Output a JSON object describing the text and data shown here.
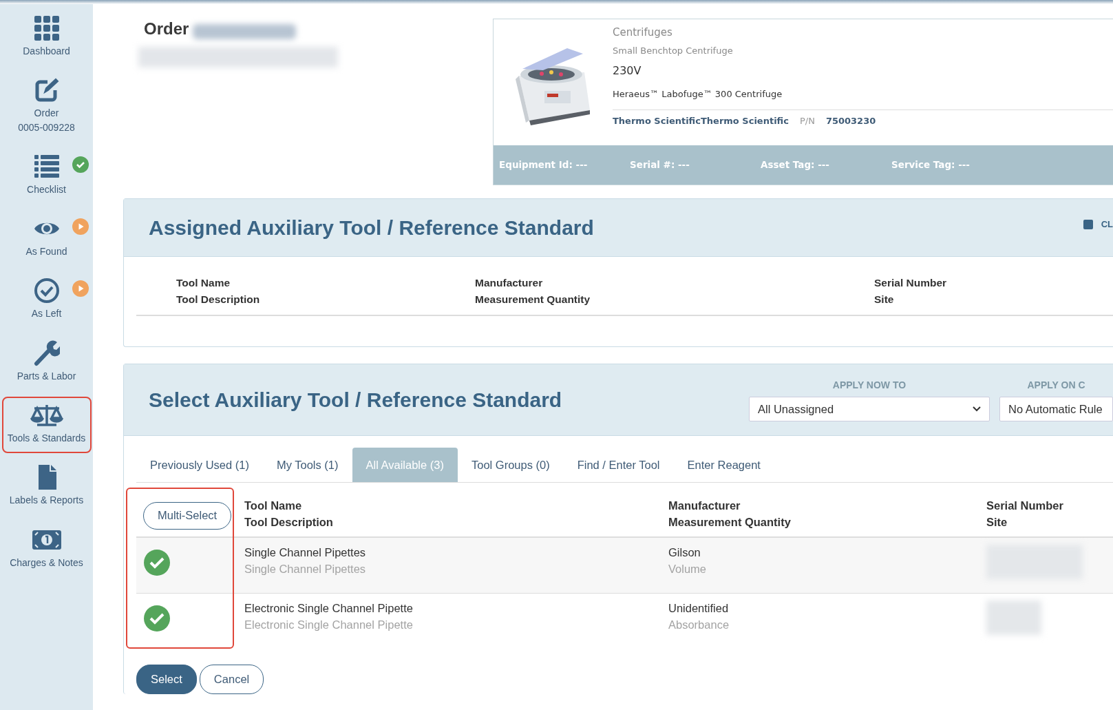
{
  "sidebar": {
    "items": [
      {
        "label": "Dashboard",
        "selected": false
      },
      {
        "label": "Order",
        "sublabel": "0005-009228",
        "selected": false
      },
      {
        "label": "Checklist",
        "completed": true,
        "selected": false
      },
      {
        "label": "As Found",
        "in_progress": true,
        "selected": false
      },
      {
        "label": "As Left",
        "in_progress": true,
        "selected": false
      },
      {
        "label": "Parts & Labor",
        "selected": false
      },
      {
        "label": "Tools & Standards",
        "selected": true
      },
      {
        "label": "Labels & Reports",
        "selected": false
      },
      {
        "label": "Charges & Notes",
        "selected": false
      }
    ]
  },
  "order": {
    "title": "Order"
  },
  "equipment": {
    "category": "Centrifuges",
    "type": "Small Benchtop Centrifuge",
    "voltage": "230V",
    "model": "Heraeus™ Labofuge™ 300 Centrifuge",
    "manufacturer": "Thermo ScientificThermo Scientific",
    "pn_label": "P/N",
    "pn": "75003230",
    "tags": [
      {
        "label": "Equipment Id:",
        "value": "---"
      },
      {
        "label": "Serial #:",
        "value": "---"
      },
      {
        "label": "Asset Tag:",
        "value": "---"
      },
      {
        "label": "Service Tag:",
        "value": "---"
      }
    ]
  },
  "assigned": {
    "title": "Assigned Auxiliary Tool / Reference Standard",
    "toggle_label": "CL",
    "toggle_checked": true,
    "columns": [
      {
        "line1": "Tool Name",
        "line2": "Tool Description"
      },
      {
        "line1": "Manufacturer",
        "line2": "Measurement Quantity"
      },
      {
        "line1": "Serial Number",
        "line2": "Site"
      }
    ]
  },
  "select": {
    "title": "Select Auxiliary Tool / Reference Standard",
    "apply": [
      {
        "label": "APPLY NOW TO",
        "value": "All Unassigned"
      },
      {
        "label": "APPLY ON C",
        "value": "No Automatic Rule"
      }
    ],
    "tabs": [
      {
        "label": "Previously Used (1)",
        "selected": false
      },
      {
        "label": "My Tools (1)",
        "selected": false
      },
      {
        "label": "All Available (3)",
        "selected": true
      },
      {
        "label": "Tool Groups (0)",
        "selected": false
      },
      {
        "label": "Find / Enter Tool",
        "selected": false
      },
      {
        "label": "Enter Reagent",
        "selected": false
      }
    ],
    "multi_select": "Multi-Select",
    "select_column_highlighted": true,
    "columns": [
      {
        "line1": "Tool Name",
        "line2": "Tool Description"
      },
      {
        "line1": "Manufacturer",
        "line2": "Measurement Quantity"
      },
      {
        "line1": "Serial Number",
        "line2": "Site"
      }
    ],
    "rows": [
      {
        "checked": true,
        "name": "Single Channel Pipettes",
        "description": "Single Channel Pipettes",
        "manufacturer": "Gilson",
        "quantity": "Volume"
      },
      {
        "checked": true,
        "name": "Electronic Single Channel Pipette",
        "description": "Electronic Single Channel Pipette",
        "manufacturer": "Unidentified",
        "quantity": "Absorbance"
      }
    ],
    "buttons": [
      {
        "label": "Select",
        "kind": "primary"
      },
      {
        "label": "Cancel",
        "kind": "secondary"
      }
    ]
  }
}
